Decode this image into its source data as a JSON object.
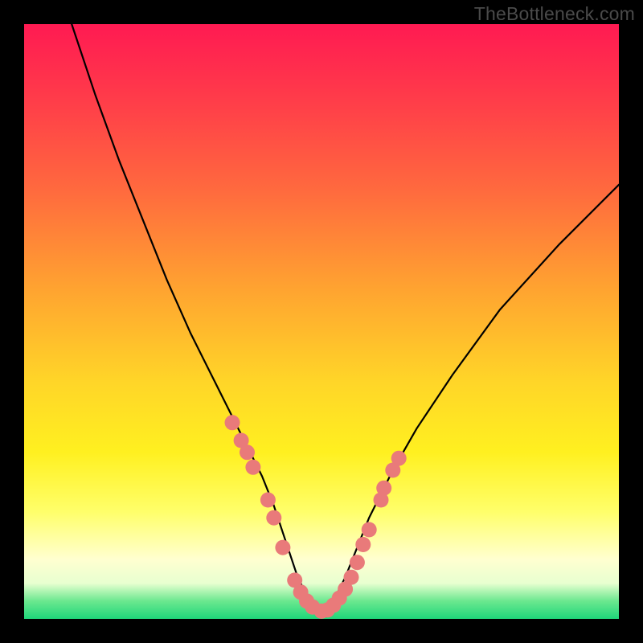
{
  "watermark": "TheBottleneck.com",
  "chart_data": {
    "type": "line",
    "title": "",
    "xlabel": "",
    "ylabel": "",
    "xlim": [
      0,
      100
    ],
    "ylim": [
      0,
      100
    ],
    "grid": false,
    "legend": false,
    "note": "Background gradient encodes bottleneck severity: red=high at top, green=low at bottom. Black V-shaped curve shows bottleneck vs. a hidden x-variable; coral dots mark sampled data points near the trough.",
    "series": [
      {
        "name": "curve",
        "color": "#000000",
        "x": [
          8,
          12,
          16,
          20,
          24,
          28,
          32,
          36,
          38,
          40,
          42,
          44,
          46,
          48,
          50,
          52,
          54,
          56,
          58,
          62,
          66,
          72,
          80,
          90,
          100
        ],
        "y": [
          100,
          88,
          77,
          67,
          57,
          48,
          40,
          32,
          28,
          24,
          19,
          13,
          7,
          3,
          1,
          3,
          7,
          12,
          17,
          25,
          32,
          41,
          52,
          63,
          73
        ]
      },
      {
        "name": "dots",
        "color": "#e97a7a",
        "type": "scatter",
        "x": [
          35.0,
          36.5,
          37.5,
          38.5,
          41.0,
          42.0,
          43.5,
          45.5,
          46.5,
          47.5,
          48.5,
          50.0,
          51.0,
          52.0,
          53.0,
          54.0,
          55.0,
          56.0,
          57.0,
          58.0,
          60.0,
          60.5,
          62.0,
          63.0
        ],
        "y": [
          33.0,
          30.0,
          28.0,
          25.5,
          20.0,
          17.0,
          12.0,
          6.5,
          4.5,
          3.0,
          2.0,
          1.3,
          1.5,
          2.3,
          3.5,
          5.0,
          7.0,
          9.5,
          12.5,
          15.0,
          20.0,
          22.0,
          25.0,
          27.0
        ]
      }
    ]
  }
}
